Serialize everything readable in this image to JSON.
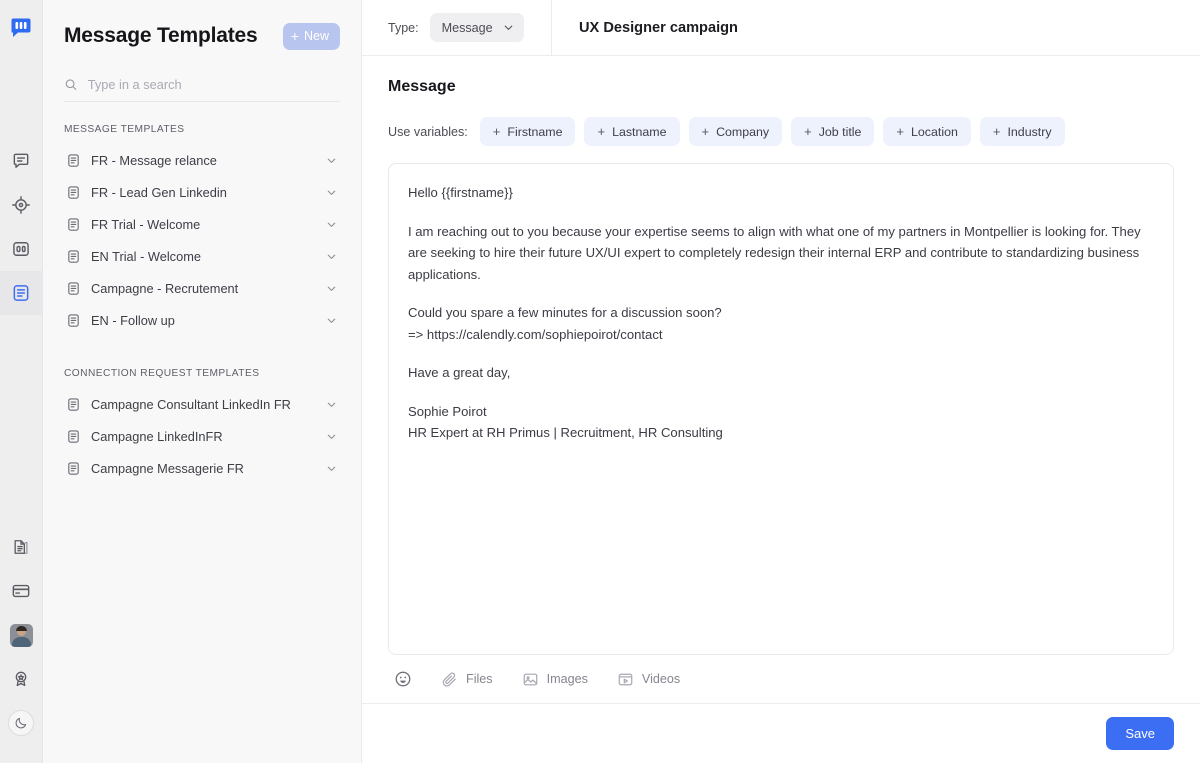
{
  "brand": {
    "logo_name": "logo-speech-bubble",
    "accent": "#3c6ef4",
    "chip_bg": "#eef2fd",
    "new_btn_bg": "#b8c6ef"
  },
  "rail": {
    "items_top": [
      {
        "icon": "chat-bubble-icon",
        "name": "rail-item-messages",
        "active": false
      },
      {
        "icon": "target-icon",
        "name": "rail-item-campaigns",
        "active": false
      },
      {
        "icon": "contacts-icon",
        "name": "rail-item-contacts",
        "active": false
      },
      {
        "icon": "templates-icon",
        "name": "rail-item-templates",
        "active": true
      }
    ],
    "items_bottom": [
      {
        "icon": "documents-icon",
        "name": "rail-item-documents"
      },
      {
        "icon": "credit-card-icon",
        "name": "rail-item-billing"
      },
      {
        "icon": "avatar-icon",
        "name": "rail-item-profile"
      },
      {
        "icon": "award-badge-icon",
        "name": "rail-item-rewards"
      },
      {
        "icon": "moon-icon",
        "name": "rail-item-dark-mode"
      }
    ]
  },
  "sidebar": {
    "title": "Message Templates",
    "new_button_label": "New",
    "search": {
      "value": "",
      "placeholder": "Type in a search"
    },
    "sections": [
      {
        "label": "MESSAGE TEMPLATES",
        "items": [
          {
            "label": "FR - Message relance"
          },
          {
            "label": "FR - Lead Gen Linkedin"
          },
          {
            "label": "FR Trial - Welcome"
          },
          {
            "label": "EN Trial - Welcome"
          },
          {
            "label": "Campagne - Recrutement"
          },
          {
            "label": "EN - Follow up"
          }
        ]
      },
      {
        "label": "CONNECTION REQUEST TEMPLATES",
        "items": [
          {
            "label": "Campagne Consultant LinkedIn FR"
          },
          {
            "label": "Campagne LinkedInFR"
          },
          {
            "label": "Campagne Messagerie FR"
          }
        ]
      }
    ]
  },
  "topbar": {
    "type_label": "Type:",
    "type_value": "Message",
    "campaign_title": "UX Designer campaign"
  },
  "main": {
    "heading": "Message",
    "variables_label": "Use variables:",
    "variables": [
      {
        "label": "Firstname"
      },
      {
        "label": "Lastname"
      },
      {
        "label": "Company"
      },
      {
        "label": "Job title"
      },
      {
        "label": "Location"
      },
      {
        "label": "Industry"
      }
    ],
    "message_paragraphs": [
      "Hello {{firstname}}",
      "I am reaching out to you because your expertise seems to align with what one of my partners in Montpellier is looking for. They are seeking to hire their future UX/UI expert to completely redesign their internal ERP and contribute to standardizing business applications.",
      "Could you spare a few minutes for a discussion soon?",
      "=> https://calendly.com/sophiepoirot/contact",
      "Have a great day,",
      "Sophie Poirot",
      "HR Expert at RH Primus | Recruitment, HR Consulting"
    ],
    "attachments": [
      {
        "label": "",
        "icon": "emoji-icon"
      },
      {
        "label": "Files",
        "icon": "paperclip-icon"
      },
      {
        "label": "Images",
        "icon": "image-icon"
      },
      {
        "label": "Videos",
        "icon": "video-icon"
      }
    ],
    "save_label": "Save"
  }
}
